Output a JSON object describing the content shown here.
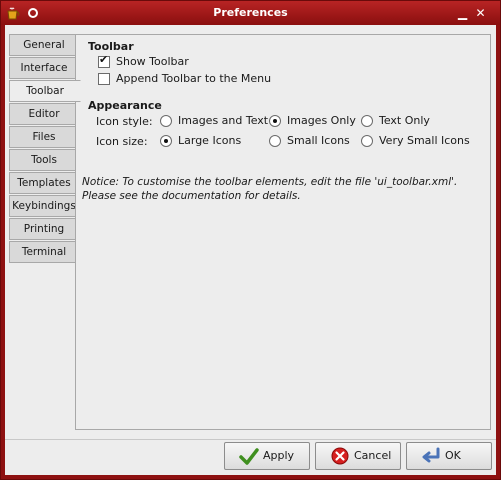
{
  "window": {
    "title": "Preferences"
  },
  "tabs": [
    "General",
    "Interface",
    "Toolbar",
    "Editor",
    "Files",
    "Tools",
    "Templates",
    "Keybindings",
    "Printing",
    "Terminal"
  ],
  "active_tab": "Toolbar",
  "toolbar_section": {
    "title": "Toolbar",
    "show_toolbar": {
      "label": "Show Toolbar",
      "checked": true
    },
    "append_toolbar": {
      "label": "Append Toolbar to the Menu",
      "checked": false
    }
  },
  "appearance_section": {
    "title": "Appearance",
    "icon_style": {
      "label": "Icon style:",
      "options": [
        "Images and Text",
        "Images Only",
        "Text Only"
      ],
      "selected": "Images Only"
    },
    "icon_size": {
      "label": "Icon size:",
      "options": [
        "Large Icons",
        "Small Icons",
        "Very Small Icons"
      ],
      "selected": "Large Icons"
    }
  },
  "notice": "Notice: To customise the toolbar elements, edit the file 'ui_toolbar.xml'. Please see the documentation for details.",
  "buttons": {
    "apply": "Apply",
    "cancel": "Cancel",
    "ok": "OK"
  },
  "colors": {
    "titlebar": "#9e1818",
    "window_bg": "#ededed"
  }
}
